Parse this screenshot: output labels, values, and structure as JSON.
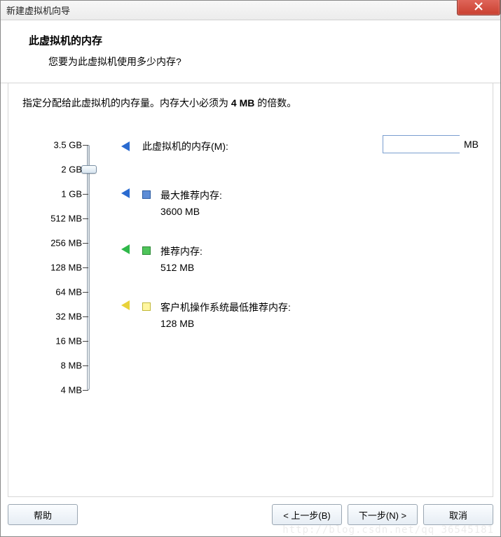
{
  "titlebar": {
    "title": "新建虚拟机向导"
  },
  "header": {
    "title": "此虚拟机的内存",
    "subtitle": "您要为此虚拟机使用多少内存?"
  },
  "instruction": {
    "pre": "指定分配给此虚拟机的内存量。内存大小必须为 ",
    "bold": "4 MB",
    "post": " 的倍数。"
  },
  "memory": {
    "label": "此虚拟机的内存(M):",
    "value": "2048",
    "unit": "MB"
  },
  "ticks": [
    {
      "label": "3.5 GB",
      "pct": 0
    },
    {
      "label": "2 GB",
      "pct": 10
    },
    {
      "label": "1 GB",
      "pct": 20
    },
    {
      "label": "512 MB",
      "pct": 30
    },
    {
      "label": "256 MB",
      "pct": 40
    },
    {
      "label": "128 MB",
      "pct": 50
    },
    {
      "label": "64 MB",
      "pct": 60
    },
    {
      "label": "32 MB",
      "pct": 70
    },
    {
      "label": "16 MB",
      "pct": 80
    },
    {
      "label": "8 MB",
      "pct": 90
    },
    {
      "label": "4 MB",
      "pct": 100
    }
  ],
  "thumb_pct": 10,
  "legends": [
    {
      "color": "blue",
      "title": "最大推荐内存:",
      "value": "3600 MB",
      "marker_pct": 30
    },
    {
      "color": "green",
      "title": "推荐内存:",
      "value": "512 MB",
      "marker_pct": 50
    },
    {
      "color": "yellow",
      "title": "客户机操作系统最低推荐内存:",
      "value": "128 MB",
      "marker_pct": 70
    }
  ],
  "buttons": {
    "help": "帮助",
    "back": "< 上一步(B)",
    "next": "下一步(N) >",
    "cancel": "取消"
  },
  "watermark": "http://blog.csdn.net/qq_36545181"
}
